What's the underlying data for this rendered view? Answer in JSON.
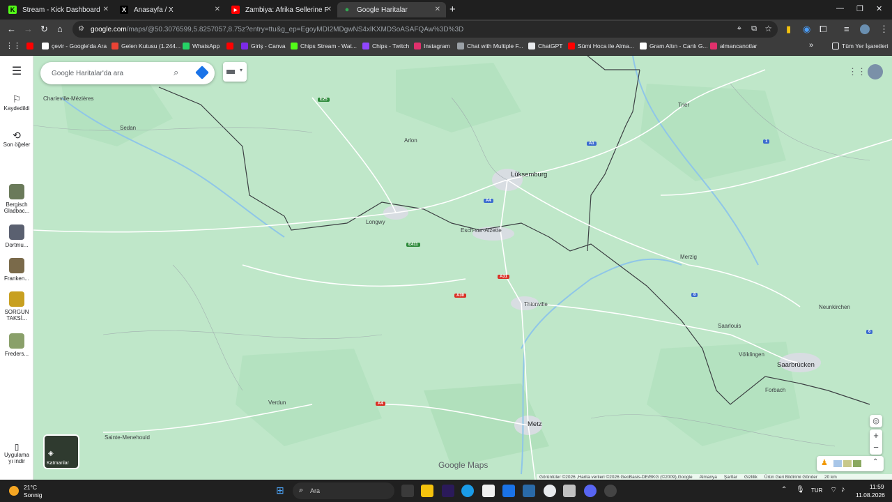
{
  "browser": {
    "tabs": [
      {
        "title": "Stream - Kick Dashboard",
        "icon": "kick-icon",
        "color": "#53fc18",
        "glyph": "K",
        "active": false
      },
      {
        "title": "Anasayfa / X",
        "icon": "x-icon",
        "color": "#000000",
        "glyph": "X",
        "active": false
      },
      {
        "title": "Zambiya: Afrika Sellerine Frensi",
        "icon": "youtube-icon",
        "color": "#ff0000",
        "glyph": "▶",
        "active": false
      },
      {
        "title": "Google Haritalar",
        "icon": "maps-icon",
        "color": "#34a853",
        "glyph": "●",
        "active": true
      }
    ],
    "url_host": "google.com",
    "url_path": "/maps/@50.3076599,5.8257057,8.75z?entry=ttu&g_ep=EgoyMDI2MDgwNS4xlKXMDSoASAFQAw%3D%3D",
    "bookmarks": [
      {
        "label": "",
        "icon": "youtube-icon",
        "color": "#ff0000"
      },
      {
        "label": "çevir - Google'da Ara",
        "icon": "google-icon",
        "color": "#ffffff"
      },
      {
        "label": "Gelen Kutusu (1.244...",
        "icon": "gmail-icon",
        "color": "#ea4335"
      },
      {
        "label": "WhatsApp",
        "icon": "whatsapp-icon",
        "color": "#25d366"
      },
      {
        "label": "",
        "icon": "youtube-icon",
        "color": "#ff0000"
      },
      {
        "label": "Giriş - Canva",
        "icon": "canva-icon",
        "color": "#7d2ae8"
      },
      {
        "label": "Chips Stream - Wat...",
        "icon": "kick-icon",
        "color": "#53fc18"
      },
      {
        "label": "Chips - Twitch",
        "icon": "twitch-icon",
        "color": "#9146ff"
      },
      {
        "label": "Instagram",
        "icon": "instagram-icon",
        "color": "#e1306c"
      },
      {
        "label": "Chat with Multiple F...",
        "icon": "chat-icon",
        "color": "#9aa0a6"
      },
      {
        "label": "ChatGPT",
        "icon": "chatgpt-icon",
        "color": "#e8eaed"
      },
      {
        "label": "Sümi Hoca ile Alma...",
        "icon": "youtube-icon",
        "color": "#ff0000"
      },
      {
        "label": "Gram Altın - Canlı G...",
        "icon": "gold-icon",
        "color": "#ffffff"
      },
      {
        "label": "almancanotlar",
        "icon": "instagram-icon",
        "color": "#e1306c"
      }
    ],
    "all_bookmarks": "Tüm Yer İşaretleri"
  },
  "maps": {
    "search_placeholder": "Google Haritalar'da ara",
    "rail": [
      {
        "label": "Kaydedildi",
        "icon": "bookmark-icon"
      },
      {
        "label": "Son öğeler",
        "icon": "history-icon"
      },
      {
        "label": "Bergisch Gladbac...",
        "icon": "place-thumb",
        "color": "#6a7a5a"
      },
      {
        "label": "Dortmu...",
        "icon": "place-thumb",
        "color": "#5a6070"
      },
      {
        "label": "Franken...",
        "icon": "place-thumb",
        "color": "#7a6a4a"
      },
      {
        "label": "SORGUN TAKSİ...",
        "icon": "place-thumb",
        "color": "#c8a020"
      },
      {
        "label": "Freders...",
        "icon": "place-thumb",
        "color": "#8aa06a"
      }
    ],
    "install_label": "Uygulama yı indir",
    "layers_label": "Katmanlar",
    "logo": "Google Maps",
    "cities": [
      {
        "name": "Charleville-Mézières",
        "big": false
      },
      {
        "name": "Sedan",
        "big": false
      },
      {
        "name": "Arlon",
        "big": false
      },
      {
        "name": "Lüksemburg",
        "big": true
      },
      {
        "name": "Trier",
        "big": false
      },
      {
        "name": "Longwy",
        "big": false
      },
      {
        "name": "Esch-sur-Alzette",
        "big": false
      },
      {
        "name": "Merzig",
        "big": false
      },
      {
        "name": "Thionville",
        "big": false
      },
      {
        "name": "Neunkirchen",
        "big": false
      },
      {
        "name": "Saarlouis",
        "big": false
      },
      {
        "name": "Völklingen",
        "big": false
      },
      {
        "name": "Saarbrücken",
        "big": true
      },
      {
        "name": "Forbach",
        "big": false
      },
      {
        "name": "Verdun",
        "big": false
      },
      {
        "name": "Metz",
        "big": true
      },
      {
        "name": "Sainte-Menehould",
        "big": false
      }
    ],
    "shields": [
      {
        "label": "E25",
        "color": "green"
      },
      {
        "label": "A1",
        "color": "blue"
      },
      {
        "label": "1",
        "color": "blue"
      },
      {
        "label": "A4",
        "color": "blue"
      },
      {
        "label": "E411",
        "color": "green"
      },
      {
        "label": "A31",
        "color": "red"
      },
      {
        "label": "A30",
        "color": "red"
      },
      {
        "label": "8",
        "color": "blue"
      },
      {
        "label": "6",
        "color": "blue"
      },
      {
        "label": "A4",
        "color": "red"
      }
    ],
    "attribution": [
      "Görüntüler ©2026 ,Harita verileri ©2026 GeoBasis-DE/BKG (©2009),Google",
      "Almanya",
      "Şartlar",
      "Gizlilik",
      "Ürün Geri Bildirimi Gönder",
      "20 km"
    ]
  },
  "taskbar": {
    "weather_temp": "21°C",
    "weather_desc": "Sonnig",
    "search_label": "Ara",
    "lang": "TUR",
    "time": "11:59",
    "date": "11.08.2026"
  }
}
